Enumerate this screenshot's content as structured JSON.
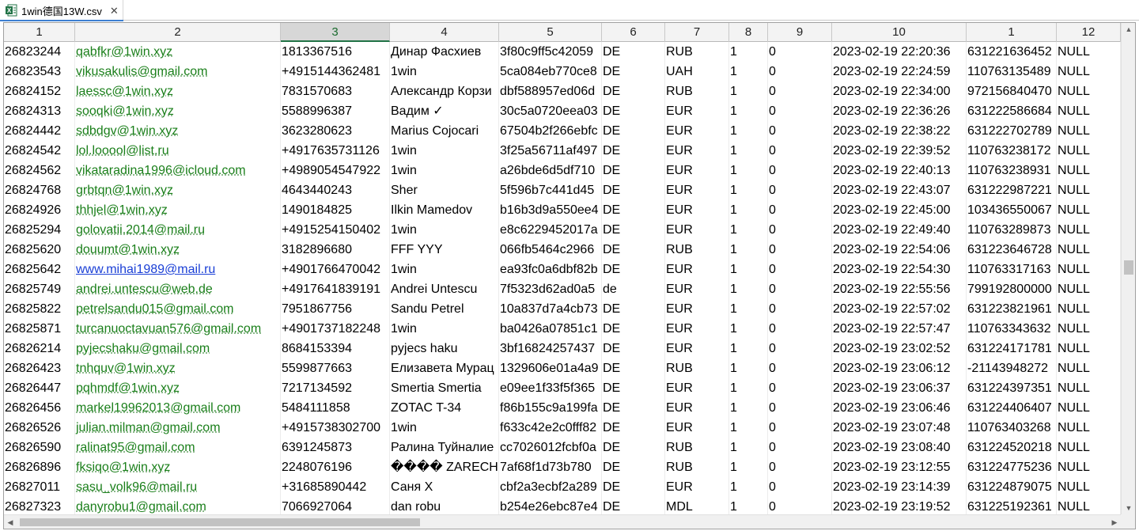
{
  "tab": {
    "title": "1win德国13W.csv",
    "close_glyph": "✕",
    "icon": "excel-file-icon"
  },
  "columns": [
    "1",
    "2",
    "3",
    "4",
    "5",
    "6",
    "7",
    "8",
    "9",
    "10",
    "1",
    "12"
  ],
  "active_column_index": 2,
  "rows": [
    [
      "26823244",
      "qabfkr@1win.xyz",
      "1813367516",
      "Динар Фасхиев",
      "3f80c9ff5c42059",
      "DE",
      "RUB",
      "1",
      "0",
      "2023-02-19 22:20:36",
      "631221636452",
      "NULL"
    ],
    [
      "26823543",
      "vikusakulis@gmail.com",
      "+4915144362481",
      "1win",
      "5ca084eb770ce8",
      "DE",
      "UAH",
      "1",
      "0",
      "2023-02-19 22:24:59",
      "110763135489",
      "NULL"
    ],
    [
      "26824152",
      "laessc@1win.xyz",
      "7831570683",
      "Александр Корзи",
      "dbf588957ed06d",
      "DE",
      "RUB",
      "1",
      "0",
      "2023-02-19 22:34:00",
      "972156840470",
      "NULL"
    ],
    [
      "26824313",
      "sooqki@1win.xyz",
      "5588996387",
      "Вадим ✓",
      "30c5a0720eea03",
      "DE",
      "EUR",
      "1",
      "0",
      "2023-02-19 22:36:26",
      "631222586684",
      "NULL"
    ],
    [
      "26824442",
      "sdbdgv@1win.xyz",
      "3623280623",
      "Marius Cojocari",
      "67504b2f266ebfc",
      "DE",
      "EUR",
      "1",
      "0",
      "2023-02-19 22:38:22",
      "631222702789",
      "NULL"
    ],
    [
      "26824542",
      "lol.looool@list.ru",
      "+4917635731126",
      "1win",
      "3f25a56711af497",
      "DE",
      "EUR",
      "1",
      "0",
      "2023-02-19 22:39:52",
      "110763238172",
      "NULL"
    ],
    [
      "26824562",
      "vikataradina1996@icloud.com",
      "+4989054547922",
      "1win",
      "a26bde6d5df710",
      "DE",
      "EUR",
      "1",
      "0",
      "2023-02-19 22:40:13",
      "110763238931",
      "NULL"
    ],
    [
      "26824768",
      "grbtqn@1win.xyz",
      "4643440243",
      "Sher",
      "5f596b7c441d45",
      "DE",
      "EUR",
      "1",
      "0",
      "2023-02-19 22:43:07",
      "631222987221",
      "NULL"
    ],
    [
      "26824926",
      "thhjel@1win.xyz",
      "1490184825",
      "Ilkin Mamedov",
      "b16b3d9a550ee4",
      "DE",
      "EUR",
      "1",
      "0",
      "2023-02-19 22:45:00",
      "103436550067",
      "NULL"
    ],
    [
      "26825294",
      "golovatii.2014@mail.ru",
      "+4915254150402",
      "1win",
      "e8c6229452017a",
      "DE",
      "EUR",
      "1",
      "0",
      "2023-02-19 22:49:40",
      "110763289873",
      "NULL"
    ],
    [
      "26825620",
      "douumt@1win.xyz",
      "3182896680",
      "FFF YYY",
      "066fb5464c2966",
      "DE",
      "RUB",
      "1",
      "0",
      "2023-02-19 22:54:06",
      "631223646728",
      "NULL"
    ],
    [
      "26825642",
      "www.mihai1989@mail.ru",
      "+4901766470042",
      "1win",
      "ea93fc0a6dbf82b",
      "DE",
      "EUR",
      "1",
      "0",
      "2023-02-19 22:54:30",
      "110763317163",
      "NULL"
    ],
    [
      "26825749",
      "andrei.untescu@web.de",
      "+4917641839191",
      "Andrei Untescu",
      "7f5323d62ad0a5",
      "de",
      "EUR",
      "1",
      "0",
      "2023-02-19 22:55:56",
      "799192800000",
      "NULL"
    ],
    [
      "26825822",
      "petrelsandu015@gmail.com",
      "7951867756",
      "Sandu Petrel",
      "10a837d7a4cb73",
      "DE",
      "EUR",
      "1",
      "0",
      "2023-02-19 22:57:02",
      "631223821961",
      "NULL"
    ],
    [
      "26825871",
      "turcanuoctavuan576@gmail.com",
      "+4901737182248",
      "1win",
      "ba0426a07851c1",
      "DE",
      "EUR",
      "1",
      "0",
      "2023-02-19 22:57:47",
      "110763343632",
      "NULL"
    ],
    [
      "26826214",
      "pyjecshaku@gmail.com",
      "8684153394",
      "pyjecs haku",
      "3bf16824257437",
      "DE",
      "EUR",
      "1",
      "0",
      "2023-02-19 23:02:52",
      "631224171781",
      "NULL"
    ],
    [
      "26826423",
      "tnhquv@1win.xyz",
      "5599877663",
      "Елизавета Мурац",
      "1329606e01a4a9",
      "DE",
      "RUB",
      "1",
      "0",
      "2023-02-19 23:06:12",
      "-21143948272",
      "NULL"
    ],
    [
      "26826447",
      "pqhmdf@1win.xyz",
      "7217134592",
      "Smertia Smertia",
      "e09ee1f33f5f365",
      "DE",
      "EUR",
      "1",
      "0",
      "2023-02-19 23:06:37",
      "631224397351",
      "NULL"
    ],
    [
      "26826456",
      "markel19962013@gmail.com",
      "5484111858",
      "ZOTAC T-34",
      "f86b155c9a199fa",
      "DE",
      "EUR",
      "1",
      "0",
      "2023-02-19 23:06:46",
      "631224406407",
      "NULL"
    ],
    [
      "26826526",
      "julian.milman@gmail.com",
      "+4915738302700",
      "1win",
      "f633c42e2c0fff82",
      "DE",
      "EUR",
      "1",
      "0",
      "2023-02-19 23:07:48",
      "110763403268",
      "NULL"
    ],
    [
      "26826590",
      "ralinat95@gmail.com",
      "6391245873",
      "Ралина Туйналие",
      "cc7026012fcbf0a",
      "DE",
      "RUB",
      "1",
      "0",
      "2023-02-19 23:08:40",
      "631224520218",
      "NULL"
    ],
    [
      "26826896",
      "fksiqo@1win.xyz",
      "2248076196",
      "���� ZARECHN",
      "7af68f1d73b780",
      "DE",
      "RUB",
      "1",
      "0",
      "2023-02-19 23:12:55",
      "631224775236",
      "NULL"
    ],
    [
      "26827011",
      "sasu_volk96@mail.ru",
      "+31685890442",
      "Саня Х",
      "cbf2a3ecbf2a289",
      "DE",
      "EUR",
      "1",
      "0",
      "2023-02-19 23:14:39",
      "631224879075",
      "NULL"
    ],
    [
      "26827323",
      "danyrobu1@gmail.com",
      "7066927064",
      "dan robu",
      "b254e26ebc87e4",
      "DE",
      "MDL",
      "1",
      "0",
      "2023-02-19 23:19:52",
      "631225192361",
      "NULL"
    ]
  ],
  "visited_link_row": 11,
  "colors": {
    "link": "#1a7f1a",
    "visited_link": "#1a3fd6",
    "active_header": "#217346",
    "excel_green": "#217346"
  }
}
